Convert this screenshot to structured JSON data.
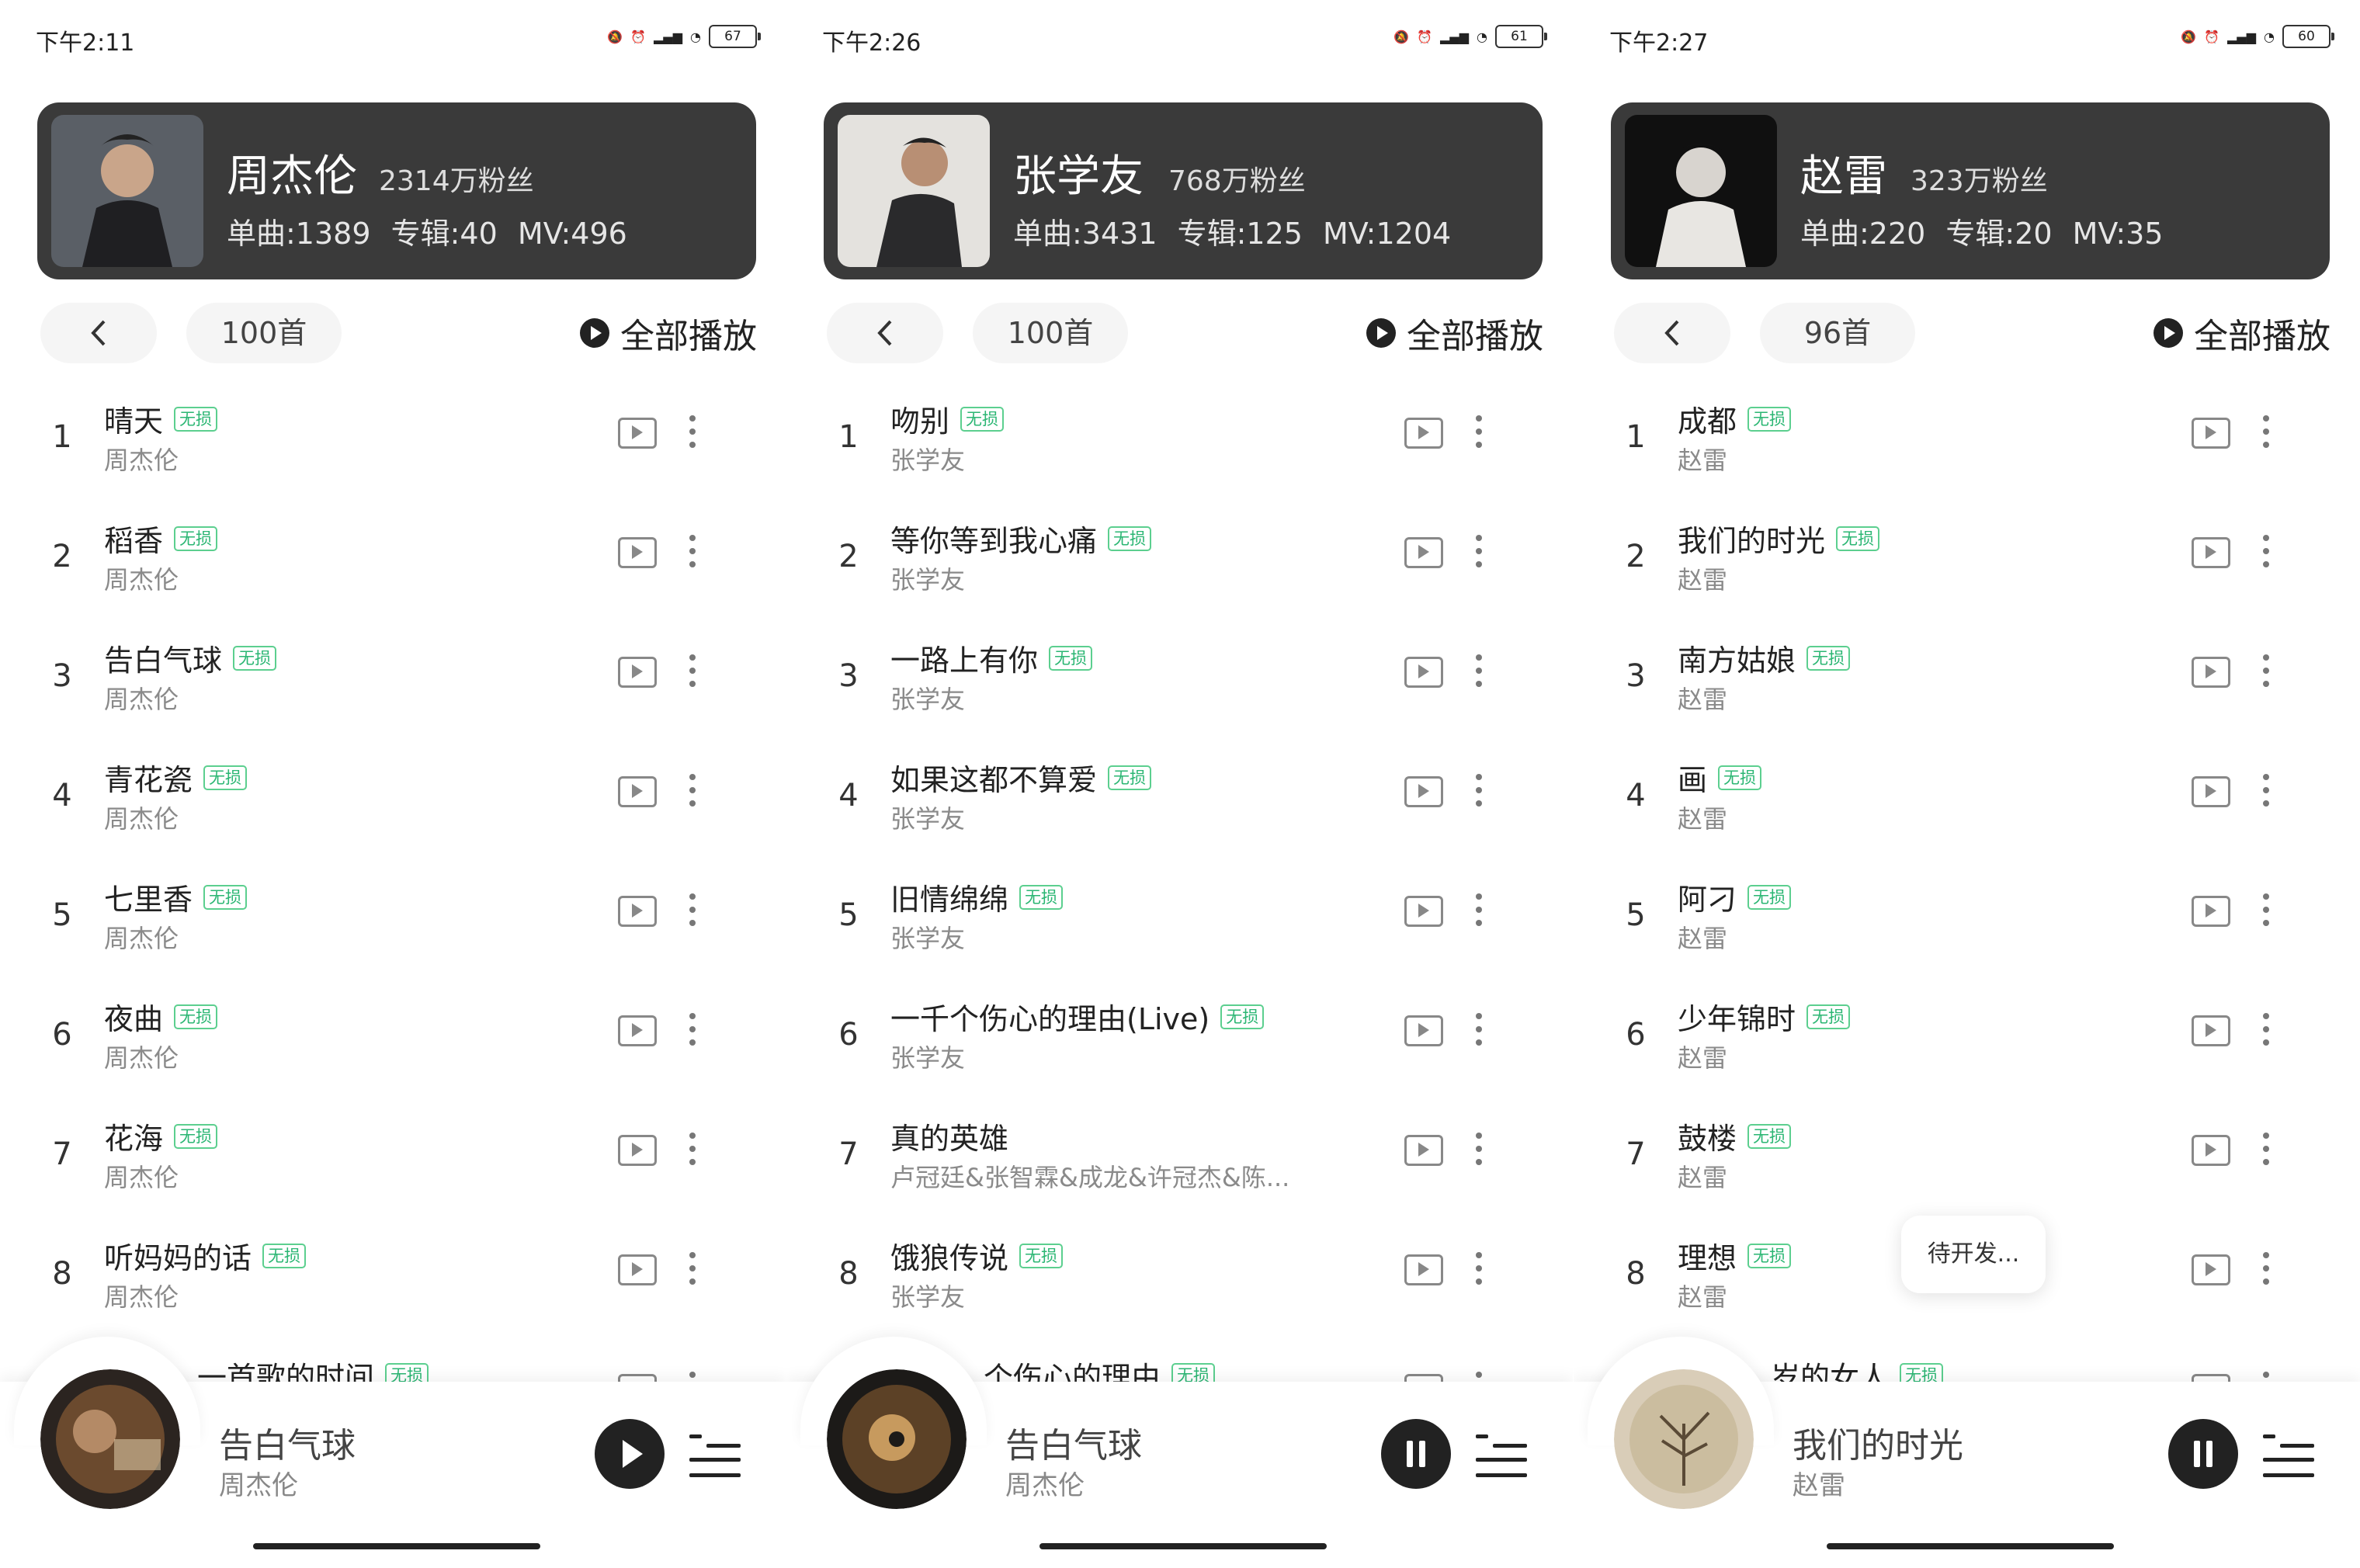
{
  "panels": [
    {
      "status_time": "下午2:11",
      "battery": "67",
      "artist": "周杰伦",
      "fans": "2314万粉丝",
      "stats": "单曲:1389 专辑:40 MV:496",
      "count": "100首",
      "play_all": "全部播放",
      "songs": [
        {
          "idx": "1",
          "title": "晴天",
          "badge": "无损",
          "artist": "周杰伦"
        },
        {
          "idx": "2",
          "title": "稻香",
          "badge": "无损",
          "artist": "周杰伦"
        },
        {
          "idx": "3",
          "title": "告白气球",
          "badge": "无损",
          "artist": "周杰伦"
        },
        {
          "idx": "4",
          "title": "青花瓷",
          "badge": "无损",
          "artist": "周杰伦"
        },
        {
          "idx": "5",
          "title": "七里香",
          "badge": "无损",
          "artist": "周杰伦"
        },
        {
          "idx": "6",
          "title": "夜曲",
          "badge": "无损",
          "artist": "周杰伦"
        },
        {
          "idx": "7",
          "title": "花海",
          "badge": "无损",
          "artist": "周杰伦"
        },
        {
          "idx": "8",
          "title": "听妈妈的话",
          "badge": "无损",
          "artist": "周杰伦"
        },
        {
          "idx": "",
          "title": "一首歌的时间",
          "badge": "无损",
          "artist": ""
        }
      ],
      "now_playing": {
        "title": "告白气球",
        "artist": "周杰伦",
        "state": "paused"
      }
    },
    {
      "status_time": "下午2:26",
      "battery": "61",
      "artist": "张学友",
      "fans": "768万粉丝",
      "stats": "单曲:3431 专辑:125 MV:1204",
      "count": "100首",
      "play_all": "全部播放",
      "songs": [
        {
          "idx": "1",
          "title": "吻别",
          "badge": "无损",
          "artist": "张学友"
        },
        {
          "idx": "2",
          "title": "等你等到我心痛",
          "badge": "无损",
          "artist": "张学友"
        },
        {
          "idx": "3",
          "title": "一路上有你",
          "badge": "无损",
          "artist": "张学友"
        },
        {
          "idx": "4",
          "title": "如果这都不算爱",
          "badge": "无损",
          "artist": "张学友"
        },
        {
          "idx": "5",
          "title": "旧情绵绵",
          "badge": "无损",
          "artist": "张学友"
        },
        {
          "idx": "6",
          "title": "一千个伤心的理由(Live)",
          "badge": "无损",
          "artist": "张学友"
        },
        {
          "idx": "7",
          "title": "真的英雄",
          "badge": "",
          "artist": "卢冠廷&张智霖&成龙&许冠杰&陈..."
        },
        {
          "idx": "8",
          "title": "饿狼传说",
          "badge": "无损",
          "artist": "张学友"
        },
        {
          "idx": "",
          "title": "个伤心的理由",
          "badge": "无损",
          "artist": ""
        }
      ],
      "now_playing": {
        "title": "告白气球",
        "artist": "周杰伦",
        "state": "playing"
      }
    },
    {
      "status_time": "下午2:27",
      "battery": "60",
      "artist": "赵雷",
      "fans": "323万粉丝",
      "stats": "单曲:220 专辑:20 MV:35",
      "count": "96首",
      "play_all": "全部播放",
      "songs": [
        {
          "idx": "1",
          "title": "成都",
          "badge": "无损",
          "artist": "赵雷"
        },
        {
          "idx": "2",
          "title": "我们的时光",
          "badge": "无损",
          "artist": "赵雷"
        },
        {
          "idx": "3",
          "title": "南方姑娘",
          "badge": "无损",
          "artist": "赵雷"
        },
        {
          "idx": "4",
          "title": "画",
          "badge": "无损",
          "artist": "赵雷"
        },
        {
          "idx": "5",
          "title": "阿刁",
          "badge": "无损",
          "artist": "赵雷"
        },
        {
          "idx": "6",
          "title": "少年锦时",
          "badge": "无损",
          "artist": "赵雷"
        },
        {
          "idx": "7",
          "title": "鼓楼",
          "badge": "无损",
          "artist": "赵雷"
        },
        {
          "idx": "8",
          "title": "理想",
          "badge": "无损",
          "artist": "赵雷"
        },
        {
          "idx": "",
          "title": "岁的女人",
          "badge": "无损",
          "artist": ""
        }
      ],
      "toast": "待开发...",
      "now_playing": {
        "title": "我们的时光",
        "artist": "赵雷",
        "state": "playing"
      }
    }
  ]
}
